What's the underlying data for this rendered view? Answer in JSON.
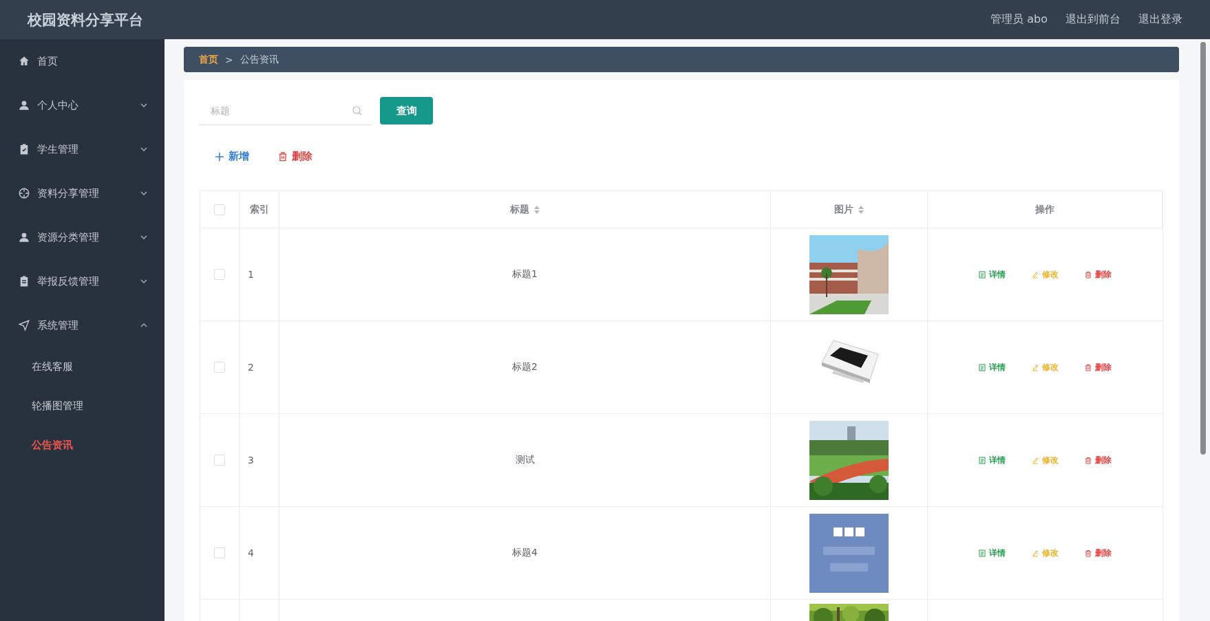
{
  "header": {
    "title": "校园资料分享平台",
    "links": [
      "管理员 abo",
      "退出到前台",
      "退出登录"
    ]
  },
  "sidebar": {
    "items": [
      {
        "label": "首页",
        "selected": false
      },
      {
        "label": "个人中心",
        "expanded": false,
        "selected": false
      },
      {
        "label": "学生管理",
        "expanded": false,
        "selected": false
      },
      {
        "label": "资料分享管理",
        "expanded": false,
        "selected": false
      },
      {
        "label": "资源分类管理",
        "expanded": false,
        "selected": false
      },
      {
        "label": "举报反馈管理",
        "expanded": false,
        "selected": false
      },
      {
        "label": "系统管理",
        "expanded": true,
        "selected": false,
        "children": [
          {
            "label": "在线客服",
            "selected": false
          },
          {
            "label": "轮播图管理",
            "selected": false
          },
          {
            "label": "公告资讯",
            "selected": true
          }
        ]
      }
    ]
  },
  "breadcrumb": {
    "home": "首页",
    "separator": ">",
    "current": "公告资讯"
  },
  "search": {
    "placeholder": "标题",
    "button": "查询"
  },
  "toolbar": [
    {
      "kind": "add",
      "label": "新增"
    },
    {
      "kind": "delete",
      "label": "删除"
    }
  ],
  "table": {
    "select_all_checked": false,
    "columns": [
      "索引",
      "标题",
      "图片",
      "操作"
    ],
    "rows": [
      {
        "checked": false,
        "index": "1",
        "title": "标题1",
        "picture": {
          "kind": "picture"
        },
        "actions": [
          {
            "kind": "detail",
            "label": "详情"
          },
          {
            "kind": "edit",
            "label": "修改"
          },
          {
            "kind": "delete",
            "label": "删除"
          }
        ]
      },
      {
        "checked": false,
        "index": "2",
        "title": "标题2",
        "picture": {
          "kind": "picture"
        },
        "actions": [
          {
            "kind": "detail",
            "label": "详情"
          },
          {
            "kind": "edit",
            "label": "修改"
          },
          {
            "kind": "delete",
            "label": "删除"
          }
        ]
      },
      {
        "checked": false,
        "index": "3",
        "title": "测试",
        "picture": {
          "kind": "picture"
        },
        "actions": [
          {
            "kind": "detail",
            "label": "详情"
          },
          {
            "kind": "edit",
            "label": "修改"
          },
          {
            "kind": "delete",
            "label": "删除"
          }
        ]
      },
      {
        "checked": false,
        "index": "4",
        "title": "标题4",
        "picture": {
          "kind": "picture"
        },
        "actions": [
          {
            "kind": "detail",
            "label": "详情"
          },
          {
            "kind": "edit",
            "label": "修改"
          },
          {
            "kind": "delete",
            "label": "删除"
          }
        ]
      }
    ],
    "partial_row": {
      "picture": {
        "kind": "picture"
      }
    }
  }
}
